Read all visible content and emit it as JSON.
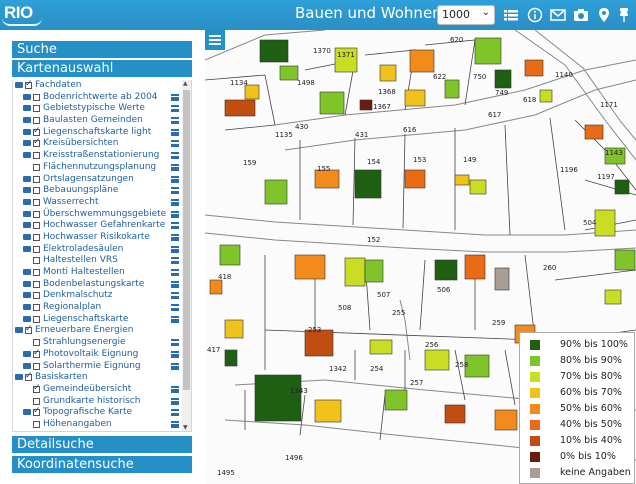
{
  "header": {
    "logo": "RIO",
    "title": "Bauen und Wohnen",
    "scale_value": "1000",
    "icons": [
      "list-icon",
      "info-icon",
      "mail-icon",
      "print-icon",
      "camera-icon",
      "location-pin-icon",
      "pin-icon"
    ]
  },
  "sidebar": {
    "search_label": "Suche",
    "map_select_label": "Kartenauswahl",
    "detail_search_label": "Detailsuche",
    "coord_search_label": "Koordinatensuche",
    "tree": [
      {
        "label": "Fachdaten",
        "level": 0,
        "folder": true,
        "checked": true,
        "menu": false
      },
      {
        "label": "Bodenrichtwerte ab 2004",
        "level": 1,
        "folder": true,
        "checked": false,
        "menu": true
      },
      {
        "label": "Gebietstypische Werte",
        "level": 1,
        "folder": true,
        "checked": false,
        "menu": true
      },
      {
        "label": "Baulasten Gemeinden",
        "level": 1,
        "folder": true,
        "checked": false,
        "menu": true
      },
      {
        "label": "Liegenschaftskarte light",
        "level": 1,
        "folder": true,
        "checked": true,
        "menu": true
      },
      {
        "label": "Kreisübersichten",
        "level": 1,
        "folder": true,
        "checked": true,
        "menu": true
      },
      {
        "label": "Kreisstraßenstationierung",
        "level": 1,
        "folder": true,
        "checked": false,
        "menu": true
      },
      {
        "label": "Flächennutzungsplanung",
        "level": 1,
        "folder": false,
        "checked": false,
        "menu": true
      },
      {
        "label": "Ortslagensatzungen",
        "level": 1,
        "folder": true,
        "checked": false,
        "menu": true
      },
      {
        "label": "Bebauungspläne",
        "level": 1,
        "folder": true,
        "checked": false,
        "menu": true
      },
      {
        "label": "Wasserrecht",
        "level": 1,
        "folder": true,
        "checked": false,
        "menu": true
      },
      {
        "label": "Überschwemmungsgebiete",
        "level": 1,
        "folder": true,
        "checked": false,
        "menu": true
      },
      {
        "label": "Hochwasser Gefahrenkarte",
        "level": 1,
        "folder": true,
        "checked": false,
        "menu": true
      },
      {
        "label": "Hochwasser Risikokarte",
        "level": 1,
        "folder": true,
        "checked": false,
        "menu": true
      },
      {
        "label": "Elektroladesäulen",
        "level": 1,
        "folder": true,
        "checked": false,
        "menu": true
      },
      {
        "label": "Haltestellen VRS",
        "level": 1,
        "folder": false,
        "checked": false,
        "menu": true
      },
      {
        "label": "Monti Haltestellen",
        "level": 1,
        "folder": true,
        "checked": false,
        "menu": true
      },
      {
        "label": "Bodenbelastungskarte",
        "level": 1,
        "folder": true,
        "checked": false,
        "menu": true
      },
      {
        "label": "Denkmalschutz",
        "level": 1,
        "folder": true,
        "checked": false,
        "menu": true
      },
      {
        "label": "Regionalplan",
        "level": 1,
        "folder": true,
        "checked": false,
        "menu": true
      },
      {
        "label": "Liegenschaftskarte",
        "level": 1,
        "folder": true,
        "checked": false,
        "menu": true
      },
      {
        "label": "Erneuerbare Energien",
        "level": 0,
        "folder": true,
        "checked": true,
        "menu": false
      },
      {
        "label": "Strahlungsenergie",
        "level": 1,
        "folder": false,
        "checked": false,
        "menu": true
      },
      {
        "label": "Photovoltaik Eignung",
        "level": 1,
        "folder": true,
        "checked": true,
        "menu": true
      },
      {
        "label": "Solarthermie Eignung",
        "level": 1,
        "folder": true,
        "checked": false,
        "menu": true
      },
      {
        "label": "Basiskarten",
        "level": 0,
        "folder": true,
        "checked": true,
        "menu": false
      },
      {
        "label": "Gemeindeübersicht",
        "level": 1,
        "folder": false,
        "checked": true,
        "menu": true
      },
      {
        "label": "Grundkarte historisch",
        "level": 1,
        "folder": false,
        "checked": false,
        "menu": true
      },
      {
        "label": "Topografische Karte",
        "level": 1,
        "folder": true,
        "checked": true,
        "menu": true
      },
      {
        "label": "Höhenangaben",
        "level": 1,
        "folder": false,
        "checked": false,
        "menu": true
      }
    ]
  },
  "legend": {
    "items": [
      {
        "label": "90% bis 100%",
        "color": "#1f5f12"
      },
      {
        "label": "80% bis 90%",
        "color": "#7fc52a"
      },
      {
        "label": "70% bis 80%",
        "color": "#c9dd24"
      },
      {
        "label": "60% bis 70%",
        "color": "#f0c21c"
      },
      {
        "label": "50% bis 60%",
        "color": "#f28a1c"
      },
      {
        "label": "40% bis 50%",
        "color": "#ea6b16"
      },
      {
        "label": "10% bis 40%",
        "color": "#c14d10"
      },
      {
        "label": "0% bis 10%",
        "color": "#6b1c10"
      },
      {
        "label": "keine Angaben",
        "color": "#a89e96"
      }
    ]
  },
  "map": {
    "parcel_labels": [
      "1370",
      "1371",
      "620",
      "1134",
      "1498",
      "1368",
      "622",
      "750",
      "749",
      "1367",
      "616",
      "617",
      "618",
      "1135",
      "430",
      "431",
      "1140",
      "1171",
      "1143",
      "159",
      "155",
      "154",
      "153",
      "149",
      "1196",
      "1197",
      "504",
      "152",
      "418",
      "507",
      "506",
      "260",
      "508",
      "255",
      "253",
      "256",
      "259",
      "417",
      "1342",
      "254",
      "258",
      "1343",
      "257",
      "1496",
      "1495"
    ]
  }
}
